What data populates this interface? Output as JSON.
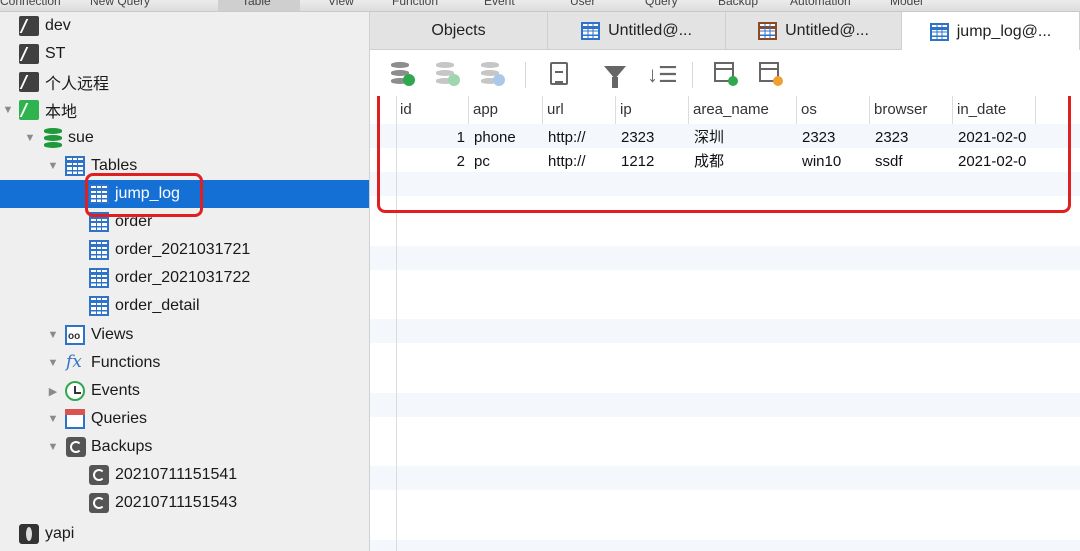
{
  "menu": [
    "Connection",
    "New Query",
    "Table",
    "View",
    "Function",
    "Event",
    "User",
    "Query",
    "Backup",
    "Automation",
    "Model"
  ],
  "sidebar": {
    "items": [
      {
        "label": "dev",
        "icon": "connection-icon"
      },
      {
        "label": "ST",
        "icon": "connection-icon"
      },
      {
        "label": "个人远程",
        "icon": "connection-icon"
      },
      {
        "label": "本地",
        "icon": "connection-icon"
      },
      {
        "label": "sue",
        "icon": "database-icon"
      },
      {
        "label": "Tables",
        "icon": "table-icon"
      },
      {
        "label": "jump_log",
        "icon": "table-icon"
      },
      {
        "label": "order",
        "icon": "table-icon"
      },
      {
        "label": "order_2021031721",
        "icon": "table-icon"
      },
      {
        "label": "order_2021031722",
        "icon": "table-icon"
      },
      {
        "label": "order_detail",
        "icon": "table-icon"
      },
      {
        "label": "Views",
        "icon": "views-icon"
      },
      {
        "label": "Functions",
        "icon": "function-icon"
      },
      {
        "label": "Events",
        "icon": "events-icon"
      },
      {
        "label": "Queries",
        "icon": "queries-icon"
      },
      {
        "label": "Backups",
        "icon": "backup-icon"
      },
      {
        "label": "20210711151541",
        "icon": "backup-icon"
      },
      {
        "label": "20210711151543",
        "icon": "backup-icon"
      },
      {
        "label": "yapi",
        "icon": "mongodb-icon"
      }
    ],
    "fx_glyph": "fx"
  },
  "tabs": [
    {
      "label": "Objects"
    },
    {
      "label": "Untitled@..."
    },
    {
      "label": "Untitled@..."
    },
    {
      "label": "jump_log@..."
    }
  ],
  "toolbar": {
    "sort_glyph": "↓☰"
  },
  "table": {
    "columns": [
      "id",
      "app",
      "url",
      "ip",
      "area_name",
      "os",
      "browser",
      "in_date"
    ],
    "rows": [
      [
        "1",
        "phone",
        "http://",
        "2323",
        "深圳",
        "2323",
        "2323",
        "2021-02-0"
      ],
      [
        "2",
        "pc",
        "http://",
        "1212",
        "成都",
        "win10",
        "ssdf",
        "2021-02-0"
      ]
    ]
  },
  "colors": {
    "selection": "#1570d6",
    "highlight_box": "#e02020",
    "table_icon": "#2f73c8",
    "connection_active": "#2fb34e"
  }
}
